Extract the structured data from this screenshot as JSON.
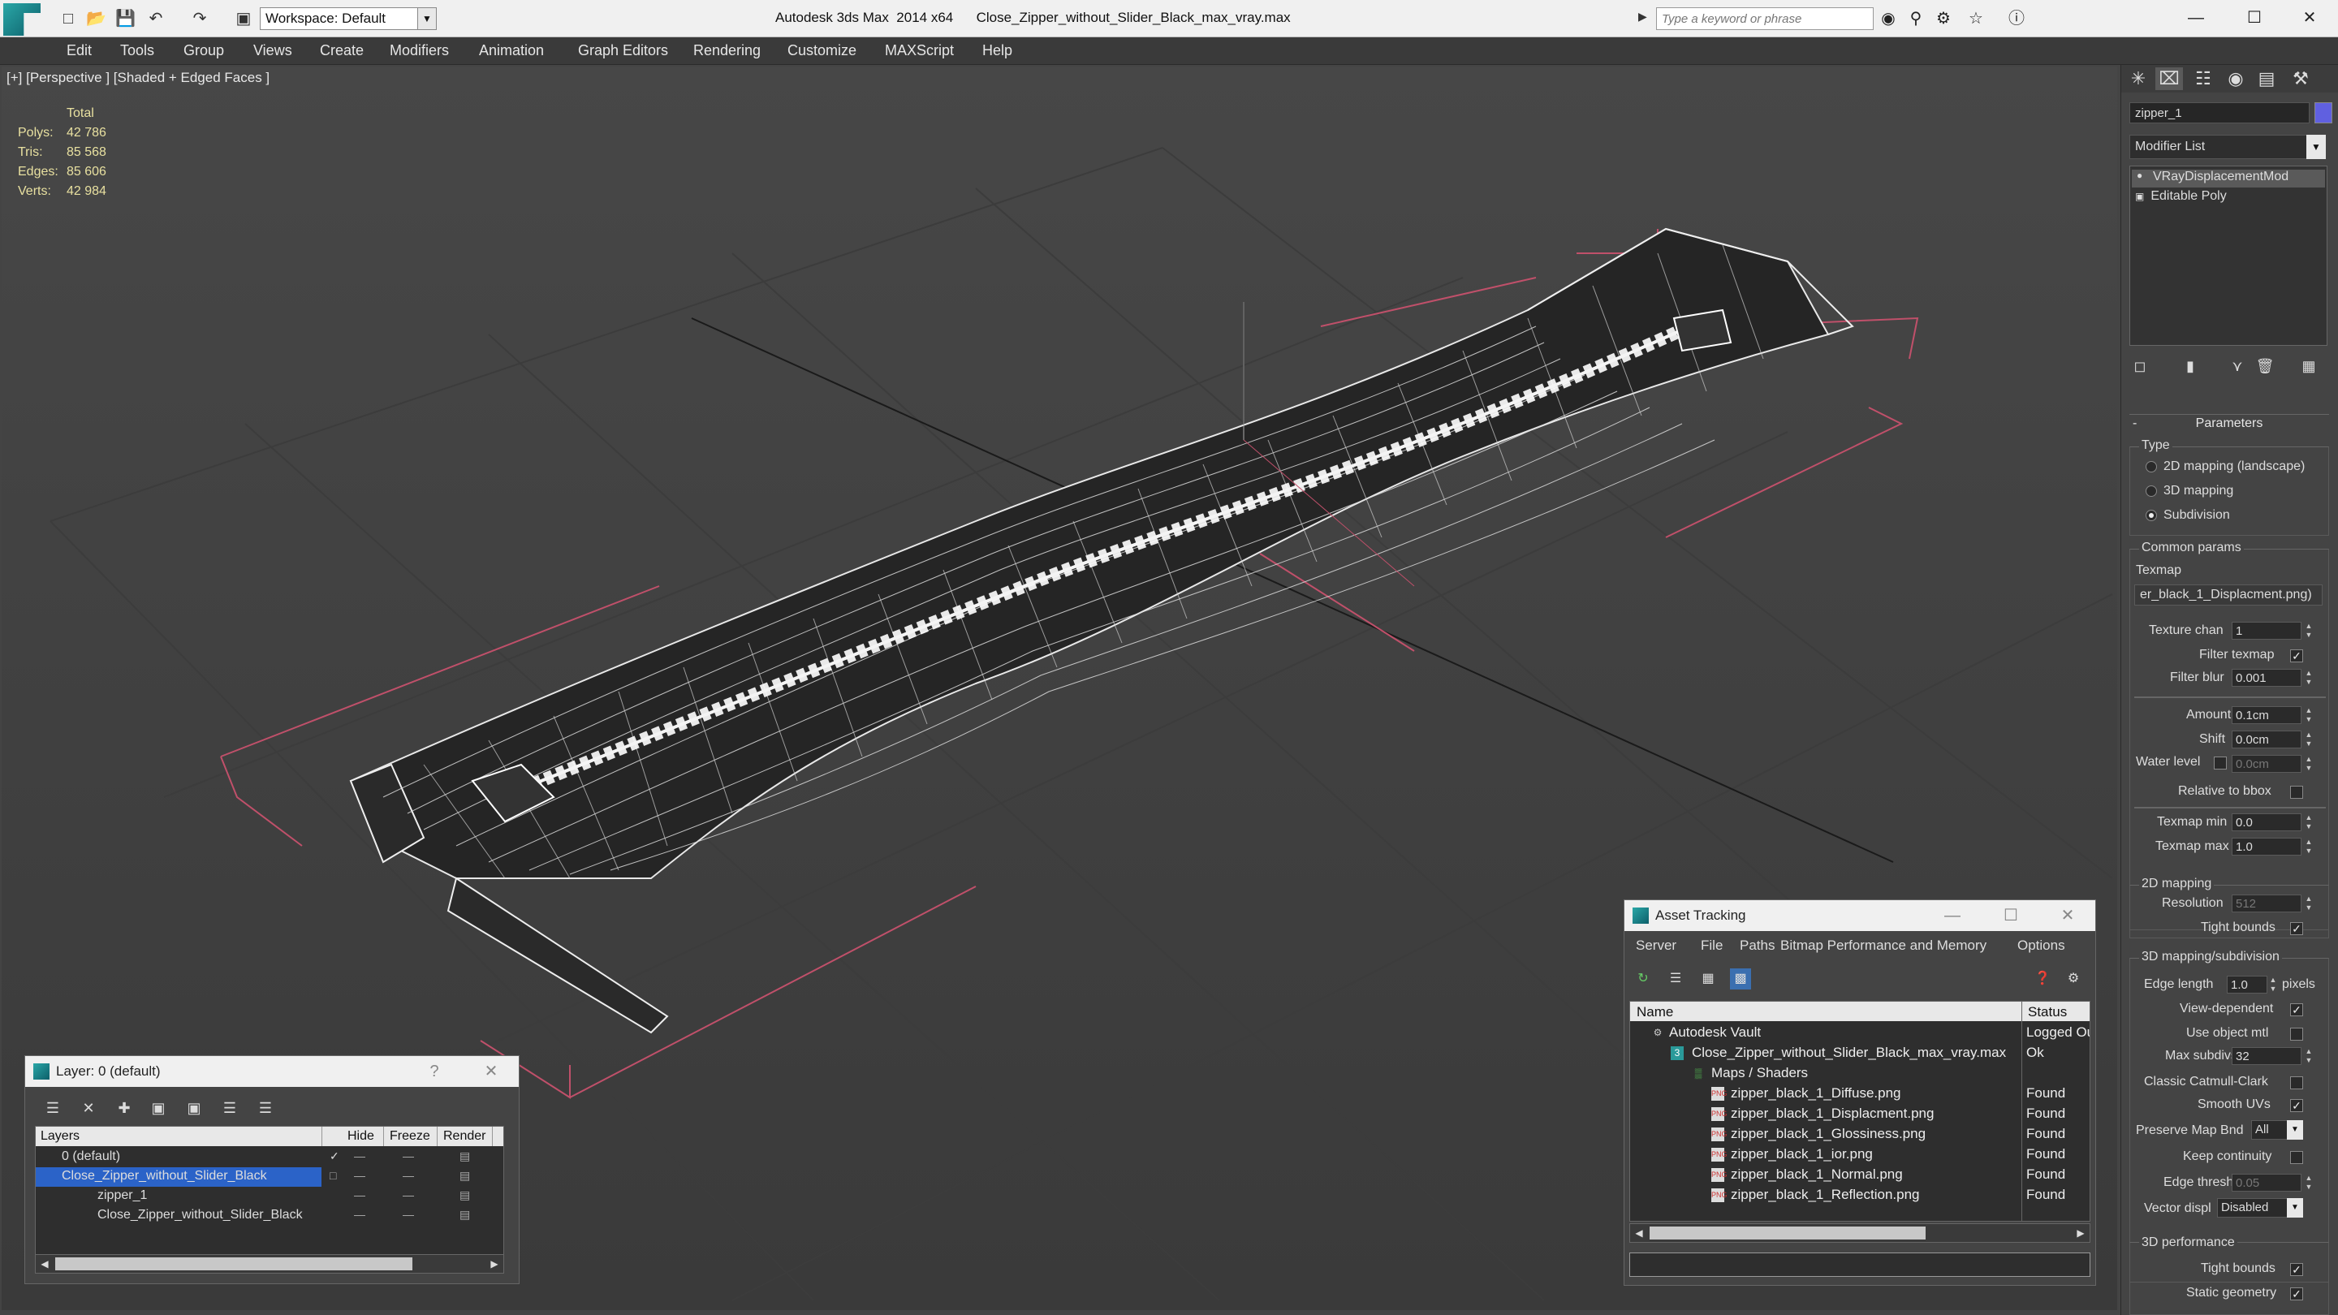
{
  "app": {
    "title": "Autodesk 3ds Max  2014 x64      Close_Zipper_without_Slider_Black_max_vray.max",
    "workspace": "Workspace: Default",
    "search_placeholder": "Type a keyword or phrase"
  },
  "menu": [
    "Edit",
    "Tools",
    "Group",
    "Views",
    "Create",
    "Modifiers",
    "Animation",
    "Graph Editors",
    "Rendering",
    "Customize",
    "MAXScript",
    "Help"
  ],
  "viewport": {
    "label": "[+] [Perspective ] [Shaded + Edged Faces ]",
    "stats": {
      "header": "Total",
      "rows": [
        {
          "k": "Polys:",
          "v": "42 786"
        },
        {
          "k": "Tris:",
          "v": "85 568"
        },
        {
          "k": "Edges:",
          "v": "85 606"
        },
        {
          "k": "Verts:",
          "v": "42 984"
        }
      ]
    }
  },
  "command_panel": {
    "object_name": "zipper_1",
    "object_color": "#6060e0",
    "modifier_list": "Modifier List",
    "stack": [
      "VRayDisplacementMod",
      "Editable Poly"
    ],
    "parameters_title": "Parameters",
    "type_group": "Type",
    "type_options": [
      "2D mapping (landscape)",
      "3D mapping",
      "Subdivision"
    ],
    "type_selected": 2,
    "common_group": "Common params",
    "texmap_label": "Texmap",
    "texmap_value": "er_black_1_Displacment.png)",
    "texture_chan_label": "Texture chan",
    "texture_chan": "1",
    "filter_texmap_label": "Filter texmap",
    "filter_blur_label": "Filter blur",
    "filter_blur": "0.001",
    "amount_label": "Amount",
    "amount": "0.1cm",
    "shift_label": "Shift",
    "shift": "0.0cm",
    "water_level_label": "Water level",
    "water_level": "0.0cm",
    "relative_bbox_label": "Relative to bbox",
    "texmap_min_label": "Texmap min",
    "texmap_min": "0.0",
    "texmap_max_label": "Texmap max",
    "texmap_max": "1.0",
    "mapping2d_group": "2D mapping",
    "resolution_label": "Resolution",
    "resolution": "512",
    "tight_bounds_label": "Tight bounds",
    "mapping3d_group": "3D mapping/subdivision",
    "edge_length_label": "Edge length",
    "edge_length": "1.0",
    "pixels_label": "pixels",
    "view_dependent_label": "View-dependent",
    "use_object_mtl_label": "Use object mtl",
    "max_subdivs_label": "Max subdivs",
    "max_subdivs": "32",
    "classic_catmull_label": "Classic Catmull-Clark",
    "smooth_uvs_label": "Smooth UVs",
    "preserve_map_label": "Preserve Map Bnd",
    "preserve_map": "All",
    "keep_continuity_label": "Keep continuity",
    "edge_thresh_label": "Edge thresh",
    "edge_thresh": "0.05",
    "vector_displ_label": "Vector displ",
    "vector_displ": "Disabled",
    "perf_group": "3D performance",
    "perf_tight_bounds_label": "Tight bounds",
    "static_geometry_label": "Static geometry"
  },
  "asset_tracking": {
    "title": "Asset Tracking",
    "menu": [
      "Server",
      "File",
      "Paths",
      "Bitmap Performance and Memory",
      "Options"
    ],
    "col_name": "Name",
    "col_status": "Status",
    "rows": [
      {
        "name": "Autodesk Vault",
        "status": "Logged Out",
        "icon": "vault-icon"
      },
      {
        "name": "Close_Zipper_without_Slider_Black_max_vray.max",
        "status": "Ok",
        "icon": "max-file-icon"
      },
      {
        "name": "Maps / Shaders",
        "status": "",
        "icon": "maps-folder-icon"
      },
      {
        "name": "zipper_black_1_Diffuse.png",
        "status": "Found",
        "icon": "png-icon"
      },
      {
        "name": "zipper_black_1_Displacment.png",
        "status": "Found",
        "icon": "png-icon"
      },
      {
        "name": "zipper_black_1_Glossiness.png",
        "status": "Found",
        "icon": "png-icon"
      },
      {
        "name": "zipper_black_1_ior.png",
        "status": "Found",
        "icon": "png-icon"
      },
      {
        "name": "zipper_black_1_Normal.png",
        "status": "Found",
        "icon": "png-icon"
      },
      {
        "name": "zipper_black_1_Reflection.png",
        "status": "Found",
        "icon": "png-icon"
      }
    ]
  },
  "layer_dialog": {
    "title": "Layer: 0 (default)",
    "help": "?",
    "col_layers": "Layers",
    "col_hide": "Hide",
    "col_freeze": "Freeze",
    "col_render": "Render",
    "rows": [
      {
        "name": "0 (default)",
        "selected": false
      },
      {
        "name": "Close_Zipper_without_Slider_Black",
        "selected": true
      },
      {
        "name": "zipper_1",
        "selected": false
      },
      {
        "name": "Close_Zipper_without_Slider_Black",
        "selected": false
      }
    ]
  }
}
